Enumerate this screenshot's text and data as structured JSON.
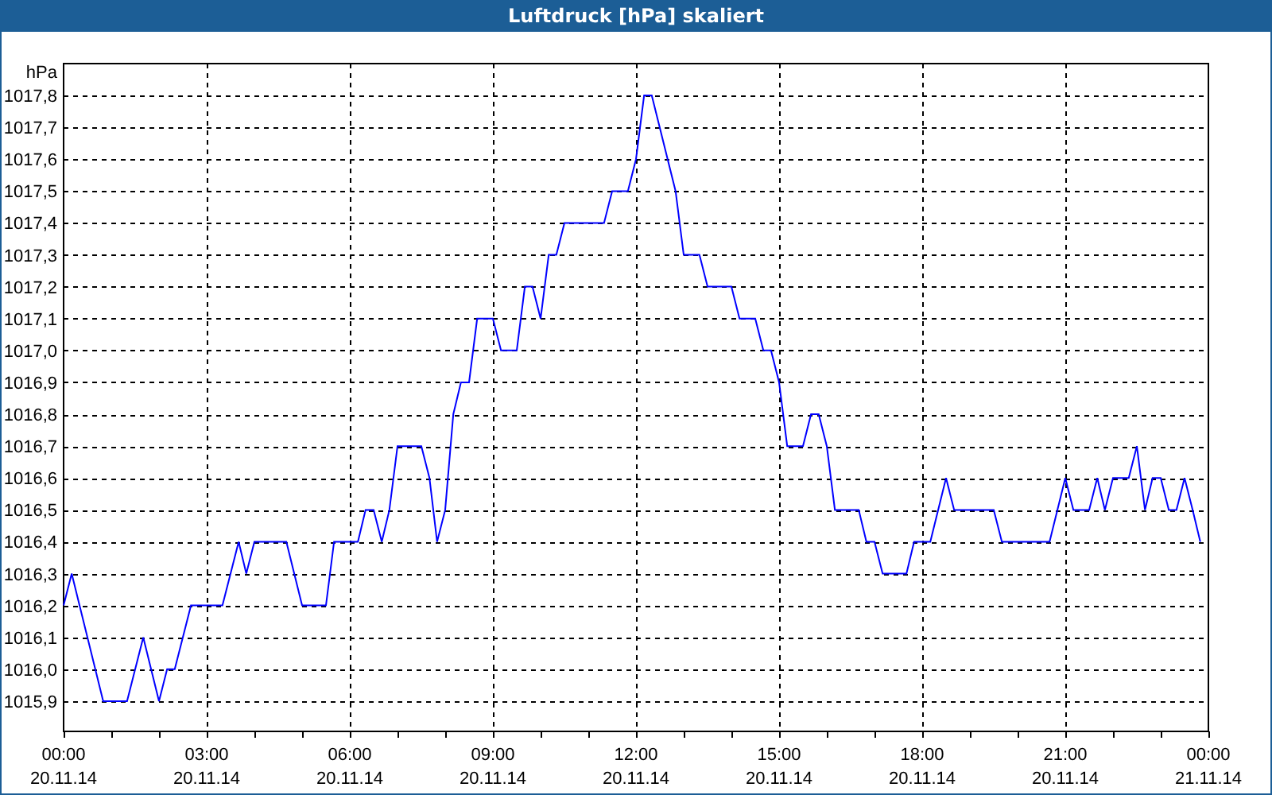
{
  "window": {
    "title": "Luftdruck [hPa] skaliert"
  },
  "chart": {
    "x_axis_dates": [
      "20.11.14",
      "20.11.14",
      "20.11.14",
      "20.11.14",
      "20.11.14",
      "20.11.14",
      "20.11.14",
      "20.11.14",
      "21.11.14"
    ],
    "chart_data": {
      "type": "line",
      "grid": true,
      "ylabel": "hPa",
      "xlim": [
        0,
        24
      ],
      "ylim": [
        1015.805,
        1017.9
      ],
      "xticks": [
        {
          "value": 0,
          "label": "00:00"
        },
        {
          "value": 3,
          "label": "03:00"
        },
        {
          "value": 6,
          "label": "06:00"
        },
        {
          "value": 9,
          "label": "09:00"
        },
        {
          "value": 12,
          "label": "12:00"
        },
        {
          "value": 15,
          "label": "15:00"
        },
        {
          "value": 18,
          "label": "18:00"
        },
        {
          "value": 21,
          "label": "21:00"
        },
        {
          "value": 24,
          "label": "00:00"
        }
      ],
      "yticks": [
        {
          "value": 1015.9,
          "label": "1015,9"
        },
        {
          "value": 1016.0,
          "label": "1016,0"
        },
        {
          "value": 1016.1,
          "label": "1016,1"
        },
        {
          "value": 1016.2,
          "label": "1016,2"
        },
        {
          "value": 1016.3,
          "label": "1016,3"
        },
        {
          "value": 1016.4,
          "label": "1016,4"
        },
        {
          "value": 1016.5,
          "label": "1016,5"
        },
        {
          "value": 1016.6,
          "label": "1016,6"
        },
        {
          "value": 1016.7,
          "label": "1016,7"
        },
        {
          "value": 1016.8,
          "label": "1016,8"
        },
        {
          "value": 1016.9,
          "label": "1016,9"
        },
        {
          "value": 1017.0,
          "label": "1017,0"
        },
        {
          "value": 1017.1,
          "label": "1017,1"
        },
        {
          "value": 1017.2,
          "label": "1017,2"
        },
        {
          "value": 1017.3,
          "label": "1017,3"
        },
        {
          "value": 1017.4,
          "label": "1017,4"
        },
        {
          "value": 1017.5,
          "label": "1017,5"
        },
        {
          "value": 1017.6,
          "label": "1017,6"
        },
        {
          "value": 1017.7,
          "label": "1017,7"
        },
        {
          "value": 1017.8,
          "label": "1017,8"
        }
      ],
      "x": [
        0,
        0.17,
        0.83,
        1.33,
        1.67,
        2.0,
        2.17,
        2.33,
        2.67,
        3.33,
        3.67,
        3.83,
        4.0,
        4.67,
        5.0,
        5.5,
        5.67,
        6.17,
        6.33,
        6.5,
        6.67,
        6.83,
        7.0,
        7.5,
        7.67,
        7.83,
        8.0,
        8.17,
        8.33,
        8.5,
        8.67,
        9.0,
        9.17,
        9.5,
        9.67,
        9.83,
        10.0,
        10.17,
        10.33,
        10.5,
        11.33,
        11.5,
        11.83,
        12.0,
        12.17,
        12.33,
        12.83,
        13.0,
        13.33,
        13.5,
        14.0,
        14.17,
        14.5,
        14.67,
        14.83,
        15.0,
        15.17,
        15.5,
        15.67,
        15.83,
        16.0,
        16.17,
        16.67,
        16.83,
        17.0,
        17.17,
        17.67,
        17.83,
        18.17,
        18.5,
        18.67,
        19.5,
        19.67,
        20.67,
        21.0,
        21.17,
        21.5,
        21.67,
        21.83,
        22.0,
        22.33,
        22.5,
        22.67,
        22.83,
        23.0,
        23.17,
        23.33,
        23.5,
        23.67,
        23.83
      ],
      "series": [
        {
          "color": "#0000ff",
          "values": [
            1016.2,
            1016.3,
            1015.9,
            1015.9,
            1016.1,
            1015.9,
            1016.0,
            1016.0,
            1016.2,
            1016.2,
            1016.4,
            1016.3,
            1016.4,
            1016.4,
            1016.2,
            1016.2,
            1016.4,
            1016.4,
            1016.5,
            1016.5,
            1016.4,
            1016.5,
            1016.7,
            1016.7,
            1016.6,
            1016.4,
            1016.5,
            1016.8,
            1016.9,
            1016.9,
            1017.1,
            1017.1,
            1017.0,
            1017.0,
            1017.2,
            1017.2,
            1017.1,
            1017.3,
            1017.3,
            1017.4,
            1017.4,
            1017.5,
            1017.5,
            1017.6,
            1017.8,
            1017.8,
            1017.5,
            1017.3,
            1017.3,
            1017.2,
            1017.2,
            1017.1,
            1017.1,
            1017.0,
            1017.0,
            1016.9,
            1016.7,
            1016.7,
            1016.8,
            1016.8,
            1016.7,
            1016.5,
            1016.5,
            1016.4,
            1016.4,
            1016.3,
            1016.3,
            1016.4,
            1016.4,
            1016.6,
            1016.5,
            1016.5,
            1016.4,
            1016.4,
            1016.6,
            1016.5,
            1016.5,
            1016.6,
            1016.5,
            1016.6,
            1016.6,
            1016.7,
            1016.5,
            1016.6,
            1016.6,
            1016.5,
            1016.5,
            1016.6,
            1016.5,
            1016.4
          ]
        }
      ]
    }
  }
}
